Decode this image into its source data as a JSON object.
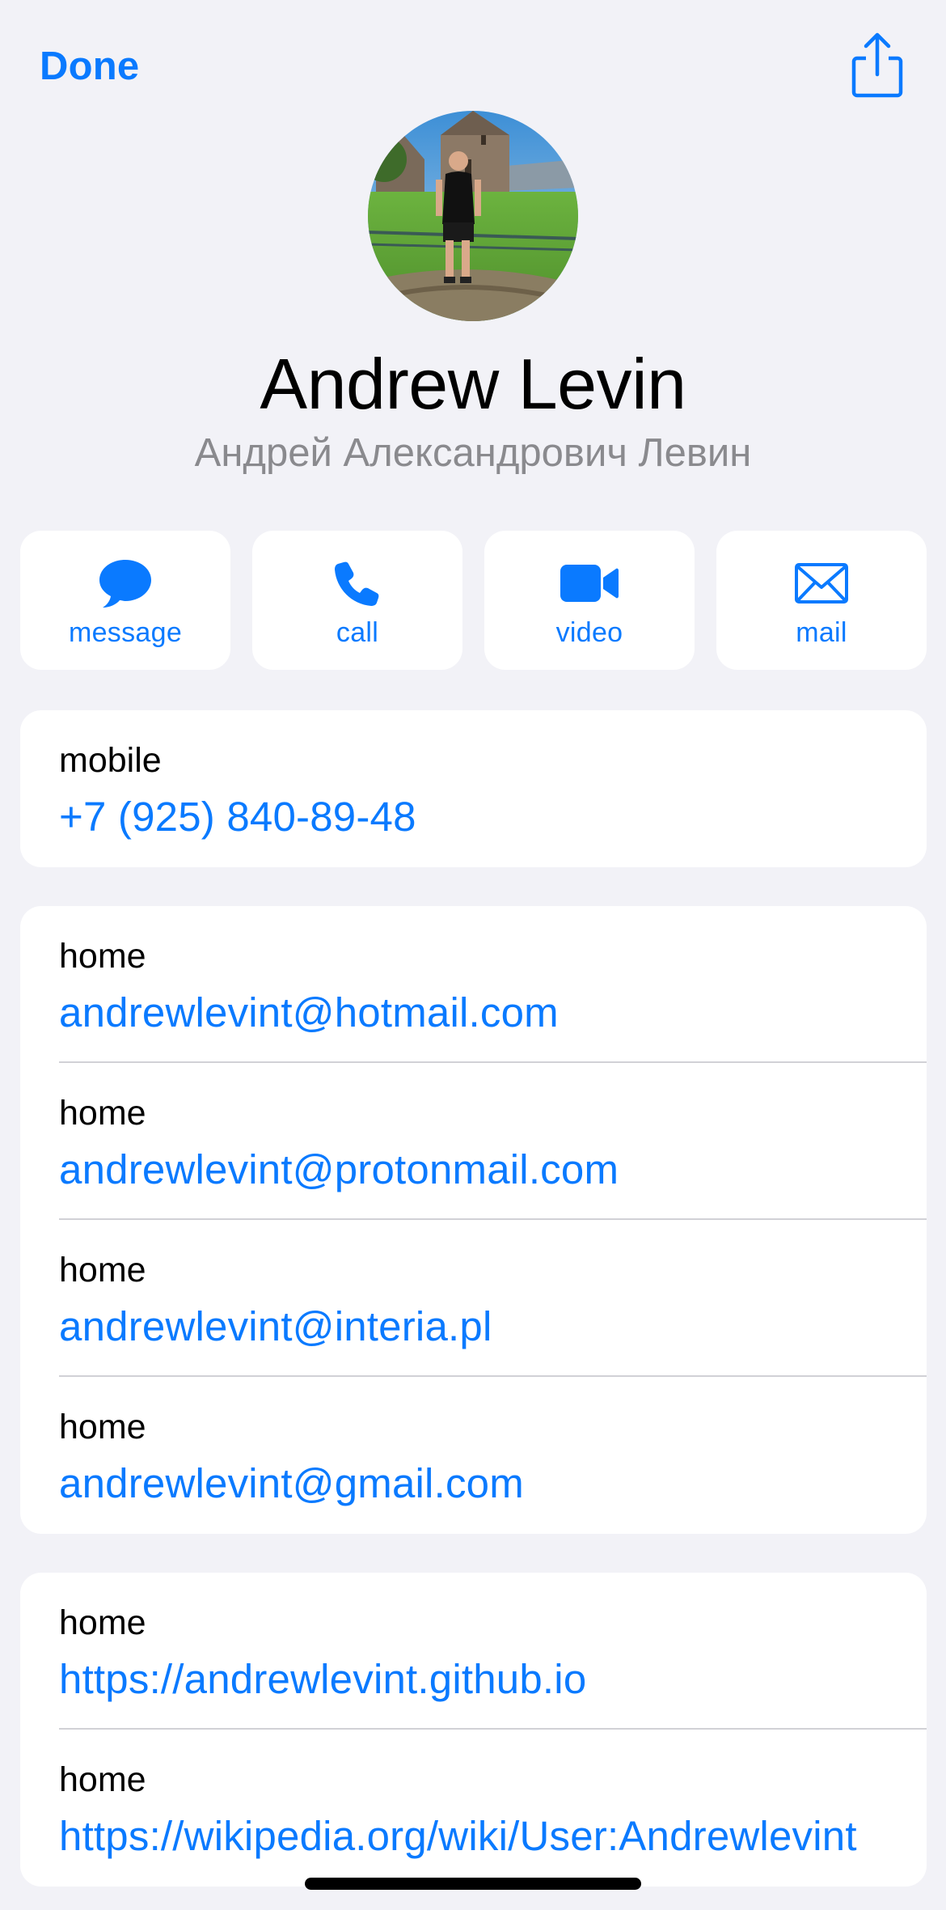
{
  "header": {
    "done_label": "Done",
    "share_icon": "share-icon"
  },
  "contact": {
    "name": "Andrew Levin",
    "subtitle": "Андрей Александрович Левин"
  },
  "actions": [
    {
      "label": "message",
      "icon": "message-bubble-icon"
    },
    {
      "label": "call",
      "icon": "phone-icon"
    },
    {
      "label": "video",
      "icon": "video-camera-icon"
    },
    {
      "label": "mail",
      "icon": "envelope-icon"
    }
  ],
  "phones": [
    {
      "label": "mobile",
      "value": "+7 (925) 840-89-48"
    }
  ],
  "emails": [
    {
      "label": "home",
      "value": "andrewlevint@hotmail.com"
    },
    {
      "label": "home",
      "value": "andrewlevint@protonmail.com"
    },
    {
      "label": "home",
      "value": "andrewlevint@interia.pl"
    },
    {
      "label": "home",
      "value": "andrewlevint@gmail.com"
    }
  ],
  "urls": [
    {
      "label": "home",
      "value": "https://andrewlevint.github.io"
    },
    {
      "label": "home",
      "value": "https://wikipedia.org/wiki/User:Andrewlevint"
    }
  ],
  "colors": {
    "accent": "#0a7aff",
    "background": "#f2f2f7",
    "card": "#ffffff",
    "secondary_text": "#8a8a8e"
  }
}
